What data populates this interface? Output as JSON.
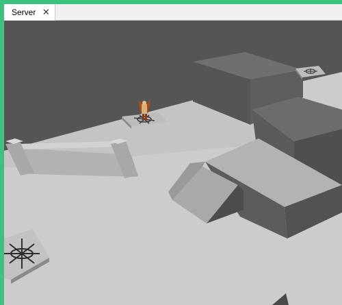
{
  "window": {
    "accent_color": "#3cc27e"
  },
  "tabs": [
    {
      "label": "Server",
      "active": true,
      "close_icon": "close-icon"
    }
  ],
  "viewport": {
    "scene": "3d-game-world",
    "colors": {
      "back_wall": "#555555",
      "floor": "#cccccc"
    },
    "objects": [
      "player-character",
      "spawn-pad",
      "low-wall",
      "ramp",
      "elevated-block",
      "stair-block"
    ]
  }
}
